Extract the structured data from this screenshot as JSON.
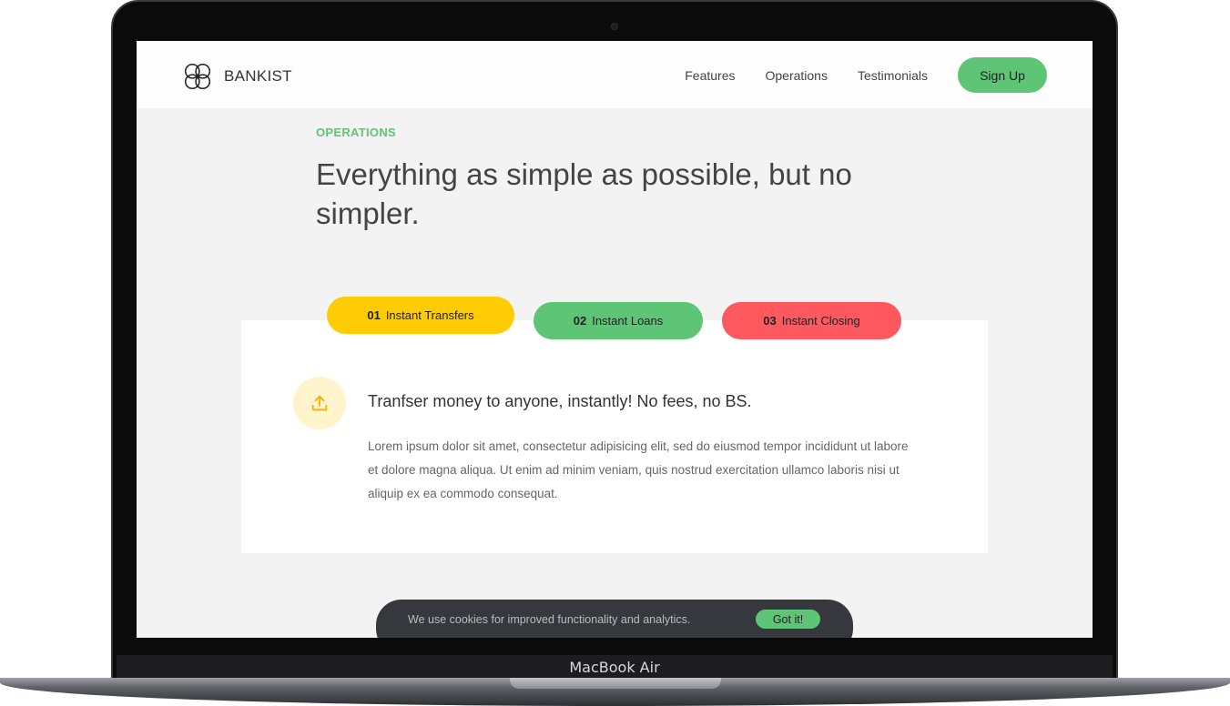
{
  "device": {
    "label": "MacBook Air"
  },
  "nav": {
    "brand": "BANKIST",
    "links": [
      "Features",
      "Operations",
      "Testimonials"
    ],
    "signup": "Sign Up"
  },
  "section": {
    "label": "OPERATIONS",
    "heading": "Everything as simple as possible, but no simpler."
  },
  "tabs": [
    {
      "num": "01",
      "label": "Instant Transfers",
      "color": "#ffcb03"
    },
    {
      "num": "02",
      "label": "Instant Loans",
      "color": "#5ec576"
    },
    {
      "num": "03",
      "label": "Instant Closing",
      "color": "#ff585f"
    }
  ],
  "operation": {
    "icon": "upload-icon",
    "title": "Tranfser money to anyone, instantly! No fees, no BS.",
    "text": "Lorem ipsum dolor sit amet, consectetur adipisicing elit, sed do eiusmod tempor incididunt ut labore et dolore magna aliqua. Ut enim ad minim veniam, quis nostrud exercitation ullamco laboris nisi ut aliquip ex ea commodo consequat."
  },
  "cookie": {
    "message": "We use cookies for improved functionality and analytics.",
    "button": "Got it!"
  },
  "colors": {
    "accent": "#5ec576",
    "yellow": "#ffcb03",
    "red": "#ff585f"
  }
}
